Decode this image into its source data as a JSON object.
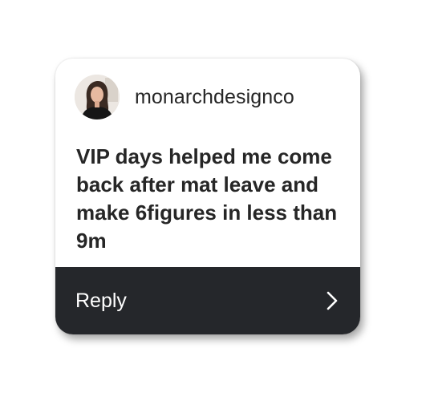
{
  "card": {
    "username": "monarchdesignco",
    "message": "VIP days helped me come back after mat leave and make 6figures in less than 9m",
    "avatar_icon": "profile-photo",
    "reply_label": "Reply",
    "reply_icon": "chevron-right-icon"
  },
  "colors": {
    "card_background": "#ffffff",
    "reply_bar": "#25272b",
    "text": "#262626",
    "reply_text": "#ffffff"
  }
}
